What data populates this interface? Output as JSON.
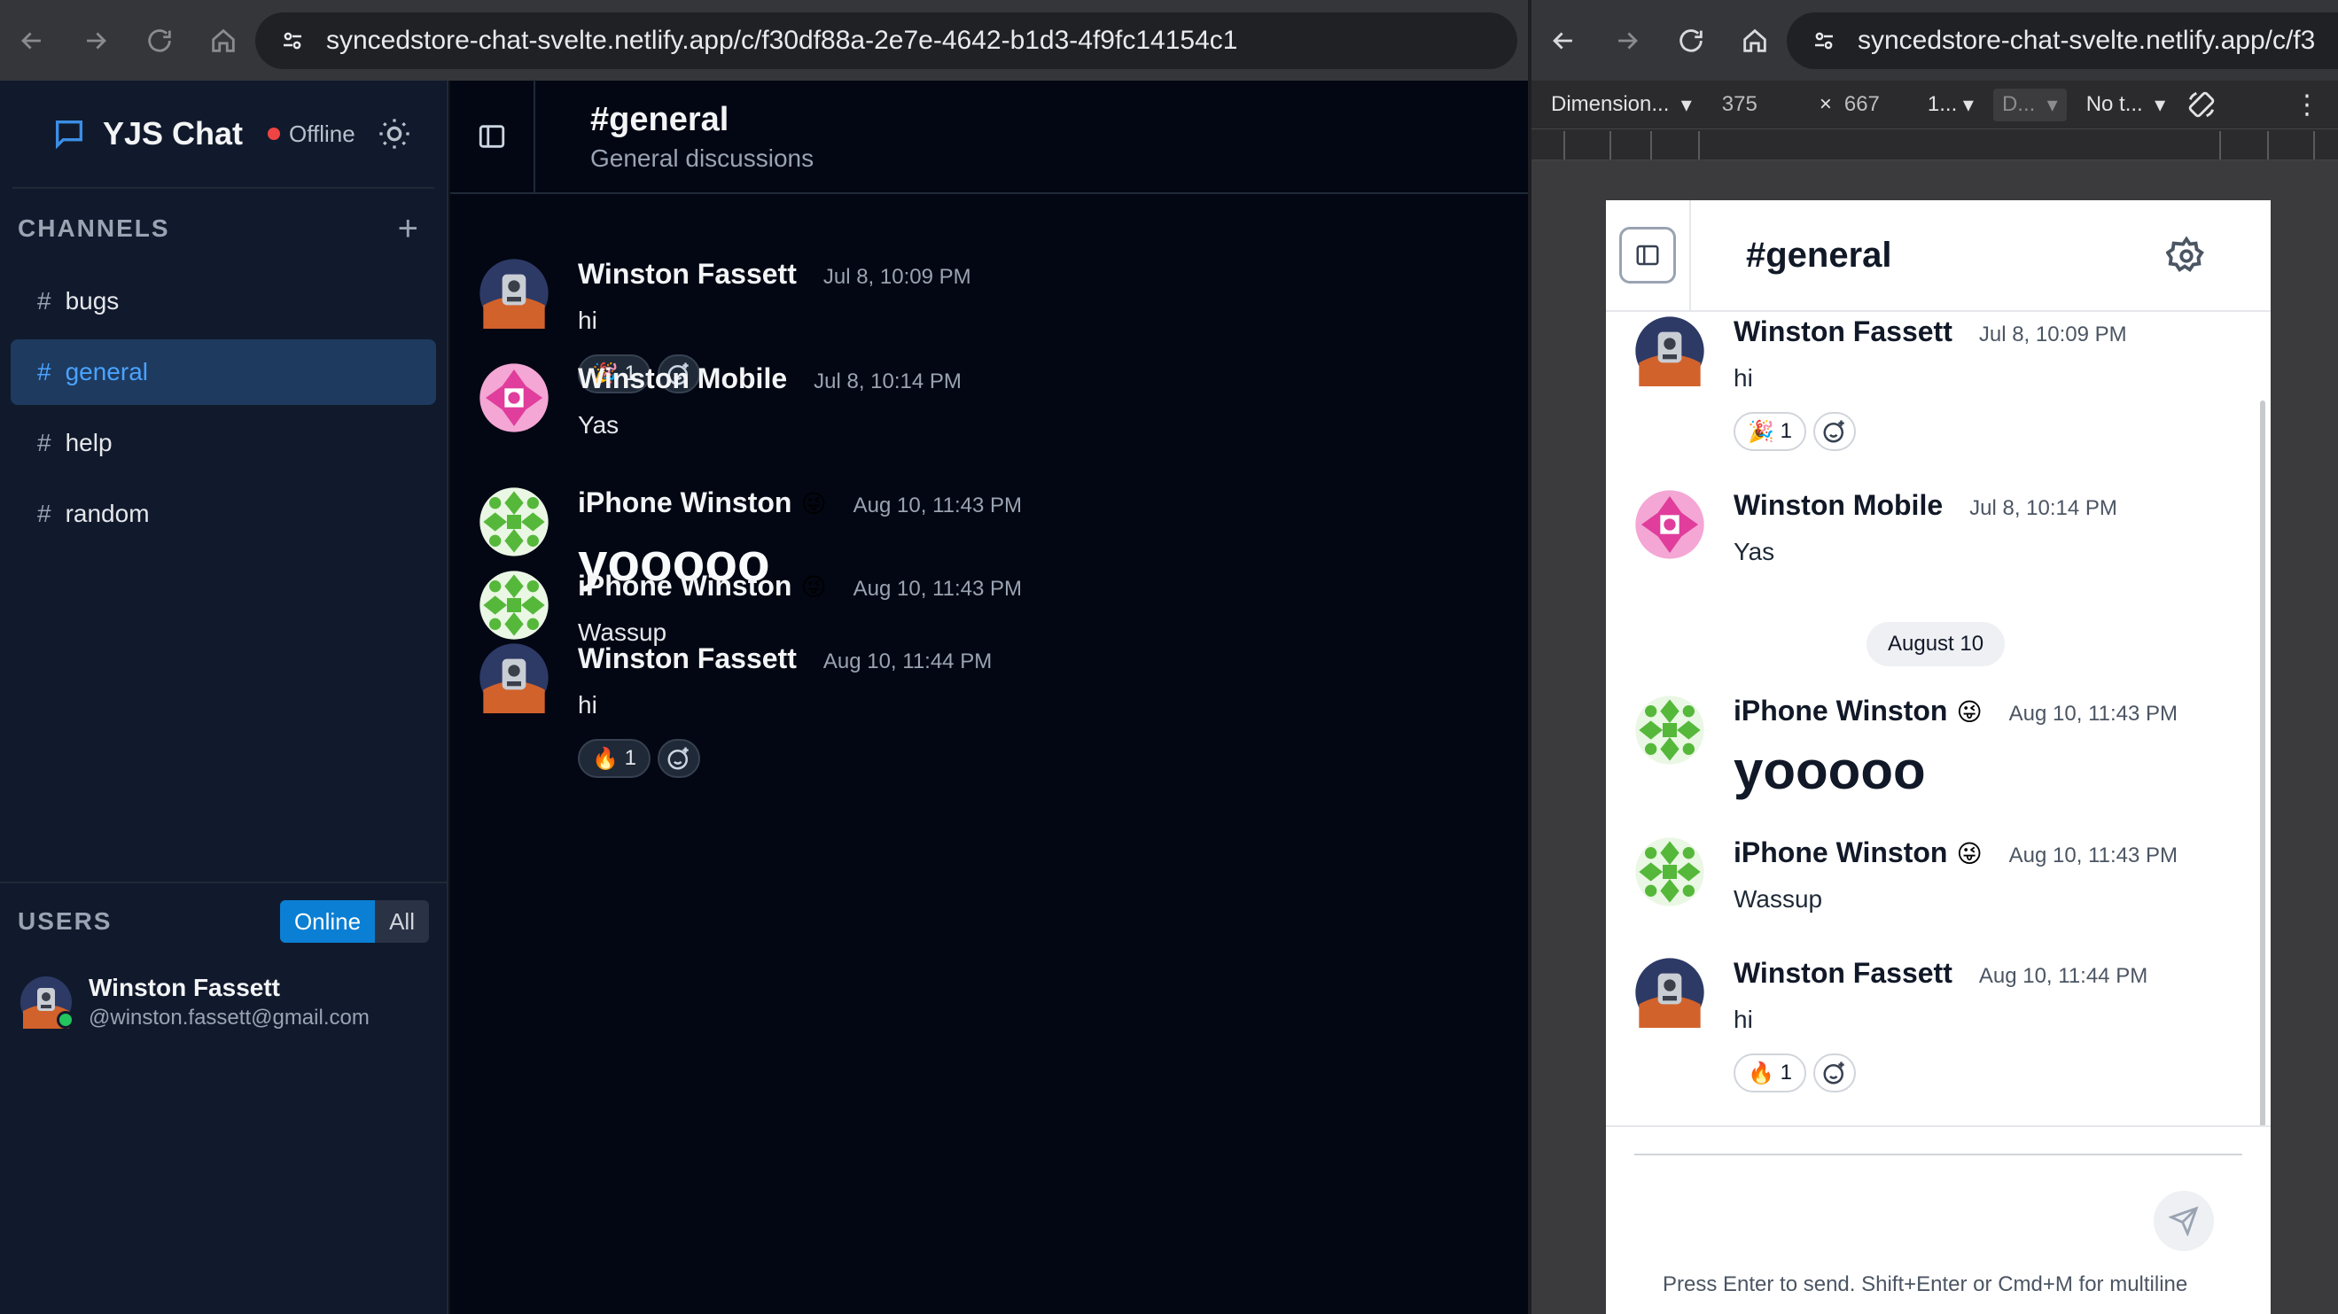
{
  "browser_left": {
    "url": "syncedstore-chat-svelte.netlify.app/c/f30df88a-2e7e-4642-b1d3-4f9fc14154c1"
  },
  "browser_right": {
    "url": "syncedstore-chat-svelte.netlify.app/c/f3"
  },
  "devtools": {
    "dimensions_label": "Dimension...",
    "width": "375",
    "times": "×",
    "height": "667",
    "zoom": "1...",
    "dpr": "D...",
    "throttle": "No t..."
  },
  "app": {
    "title": "YJS Chat",
    "status": "Offline",
    "channels_label": "CHANNELS",
    "channels": [
      {
        "name": "bugs"
      },
      {
        "name": "general"
      },
      {
        "name": "help"
      },
      {
        "name": "random"
      }
    ],
    "users_label": "USERS",
    "users_toggle": {
      "online": "Online",
      "all": "All"
    },
    "user": {
      "name": "Winston Fassett",
      "email": "@winston.fassett@gmail.com"
    }
  },
  "channel_header": {
    "title": "#general",
    "subtitle": "General discussions"
  },
  "messages": [
    {
      "author": "Winston Fassett",
      "time": "Jul 8, 10:09 PM",
      "text": "hi",
      "reaction": "🎉",
      "reaction_count": "1"
    },
    {
      "author": "Winston Mobile",
      "time": "Jul 8, 10:14 PM",
      "text": "Yas"
    },
    {
      "author": "iPhone Winston",
      "emoji": "😜",
      "time": "Aug 10, 11:43 PM",
      "text": "yooooo"
    },
    {
      "author": "iPhone Winston",
      "emoji": "😜",
      "time": "Aug 10, 11:43 PM",
      "text": "Wassup"
    },
    {
      "author": "Winston Fassett",
      "time": "Aug 10, 11:44 PM",
      "text": "hi",
      "reaction": "🔥",
      "reaction_count": "1"
    }
  ],
  "mobile": {
    "title": "#general",
    "date_separator": "August 10",
    "hint": "Press Enter to send. Shift+Enter or Cmd+M for multiline"
  },
  "colors": {
    "accent": "#0b7fd4",
    "active_channel_bg": "#1e3a5f",
    "status_offline": "#ef4444",
    "online_dot": "#22c55e"
  }
}
